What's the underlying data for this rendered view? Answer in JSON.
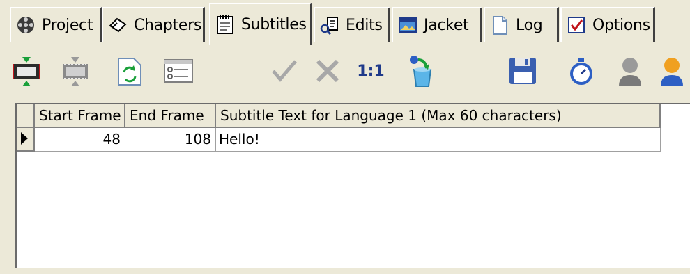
{
  "tabs": [
    {
      "label": "Project",
      "icon": "film-reel-icon"
    },
    {
      "label": "Chapters",
      "icon": "bookmark-icon"
    },
    {
      "label": "Subtitles",
      "icon": "notepad-icon",
      "active": true
    },
    {
      "label": "Edits",
      "icon": "edit-tools-icon"
    },
    {
      "label": "Jacket",
      "icon": "jacket-image-icon"
    },
    {
      "label": "Log",
      "icon": "document-icon"
    },
    {
      "label": "Options",
      "icon": "checkbox-icon"
    }
  ],
  "toolbar": {
    "ratio_label": "1:1",
    "buttons": [
      "select-frame-icon",
      "filmstrip-icon",
      "refresh-icon",
      "properties-icon",
      "check-icon",
      "cross-icon",
      "ratio-1-1",
      "recycle-bin-icon",
      "save-floppy-icon",
      "stopwatch-icon",
      "user-gray-icon",
      "user-orange-icon"
    ]
  },
  "grid": {
    "columns": [
      "Start Frame",
      "End Frame",
      "Subtitle Text for Language 1 (Max 60 characters)"
    ],
    "rows": [
      {
        "start": "48",
        "end": "108",
        "text": "Hello!"
      }
    ]
  },
  "colors": {
    "face": "#ece9d8",
    "ratio_text": "#1f3a8a",
    "accent_blue": "#2d5fc4",
    "floppy_blue": "#3a5fb0"
  }
}
